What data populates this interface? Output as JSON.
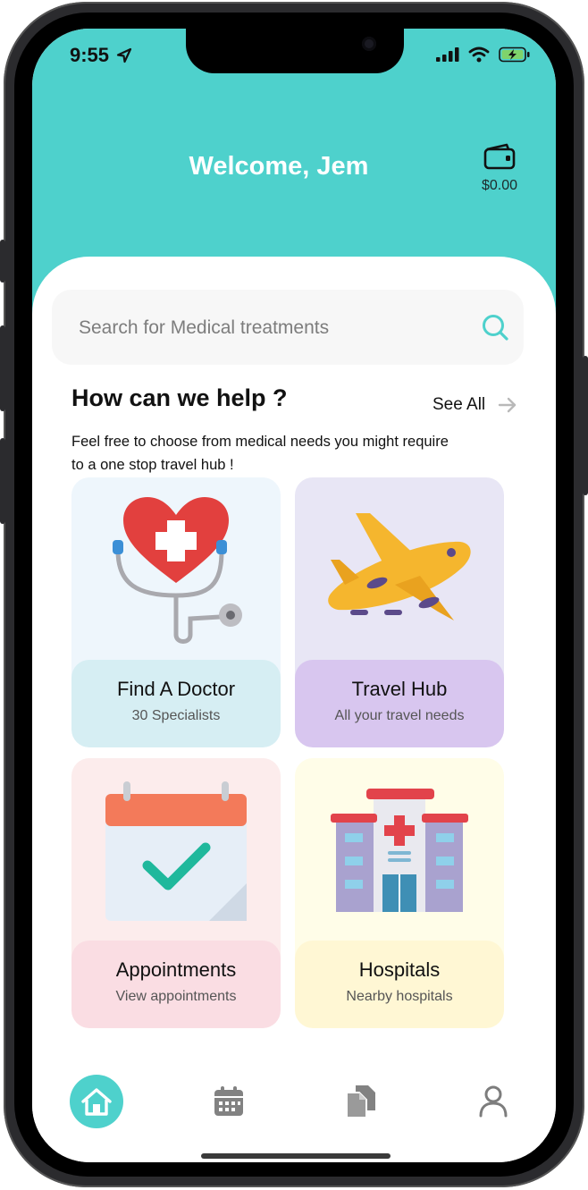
{
  "status_bar": {
    "time": "9:55"
  },
  "header": {
    "welcome": "Welcome, Jem",
    "wallet_amount": "$0.00"
  },
  "search": {
    "placeholder": "Search for Medical treatments"
  },
  "help": {
    "title": "How can we help ?",
    "see_all": "See All",
    "description": "Feel free to choose from medical needs you might require to a one stop travel hub !"
  },
  "cards": [
    {
      "title": "Find A Doctor",
      "subtitle": "30 Specialists",
      "icon": "stethoscope-heart-icon"
    },
    {
      "title": "Travel Hub",
      "subtitle": "All your travel needs",
      "icon": "airplane-icon"
    },
    {
      "title": "Appointments",
      "subtitle": "View appointments",
      "icon": "calendar-check-icon"
    },
    {
      "title": "Hospitals",
      "subtitle": "Nearby hospitals",
      "icon": "hospital-building-icon"
    }
  ],
  "tabs": [
    {
      "icon": "home-icon",
      "active": true
    },
    {
      "icon": "calendar-icon",
      "active": false
    },
    {
      "icon": "documents-icon",
      "active": false
    },
    {
      "icon": "profile-icon",
      "active": false
    }
  ],
  "colors": {
    "accent": "#4ed1cc",
    "doctor_label": "#d6eef3",
    "travel_label": "#d8c6ef",
    "appointments_label": "#fadde3",
    "hospitals_label": "#fff7d4"
  }
}
